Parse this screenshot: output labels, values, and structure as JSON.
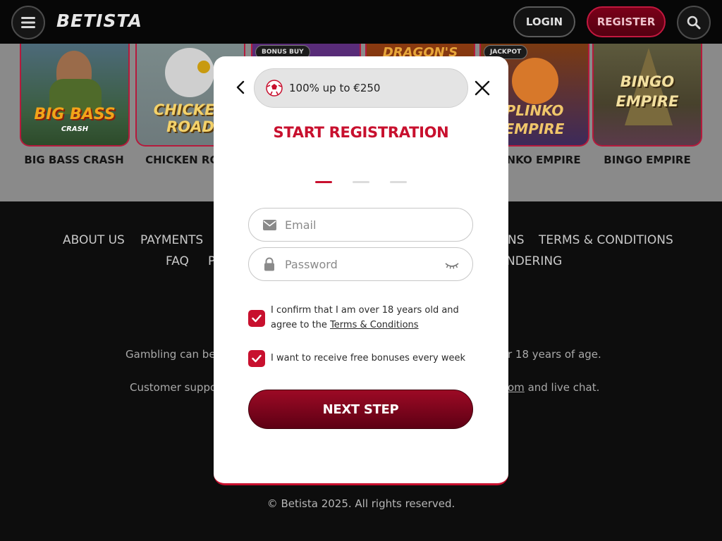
{
  "header": {
    "logo": "BETISTA",
    "login_label": "LOGIN",
    "register_label": "REGISTER"
  },
  "games": [
    {
      "name": "BIG BASS CRASH",
      "art_text": "BIG BASS",
      "art_sub": "CRASH"
    },
    {
      "name": "CHICKEN ROAD",
      "art_text": "CHICKEN ROAD",
      "art_sub": ""
    },
    {
      "name": "",
      "art_text": "",
      "tag": "BONUS BUY"
    },
    {
      "name": "",
      "art_text": "DRAGON'S",
      "art_sub": ""
    },
    {
      "name": "PLINKO EMPIRE",
      "art_text": "PLINKO EMPIRE",
      "tag": "JACKPOT"
    },
    {
      "name": "BINGO EMPIRE",
      "art_text": "BINGO EMPIRE",
      "art_sub": ""
    }
  ],
  "footer": {
    "links_row1": [
      "ABOUT US",
      "PAYMENTS",
      "NS",
      "TERMS & CONDITIONS"
    ],
    "links_row2": [
      "FAQ",
      "P",
      "NDERING"
    ],
    "gambling_left": "Gambling can be",
    "gambling_right": "r 18 years of age.",
    "support_left": "Customer suppo",
    "support_link": "om",
    "support_right": " and live chat.",
    "copyright": "© Betista 2025. All rights reserved."
  },
  "modal": {
    "promo_text": "100% up to €250",
    "title": "START REGISTRATION",
    "steps_total": 3,
    "step_current": 1,
    "email_placeholder": "Email",
    "password_placeholder": "Password",
    "age_confirm_text": "I confirm that I am over 18 years old and agree to the",
    "terms_link": "Terms & Conditions",
    "bonus_text": "I want to receive free bonuses every week",
    "age_checked": true,
    "bonus_checked": true,
    "next_label": "NEXT STEP"
  },
  "colors": {
    "accent": "#c8102e",
    "header_bg": "#070707",
    "footer_bg": "#0d0d0d",
    "overlay_strip": "#8a8a8a"
  }
}
